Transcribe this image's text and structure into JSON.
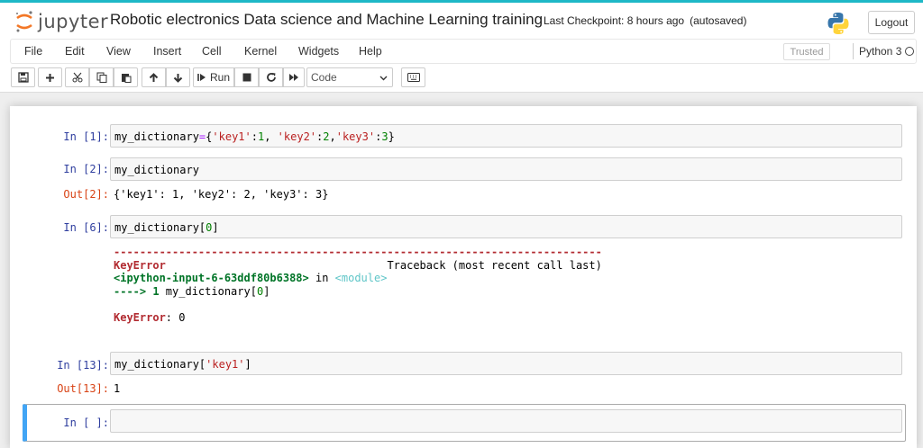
{
  "header": {
    "logo_text": "jupyter",
    "notebook_title": "Robotic electronics Data science and Machine Learning training",
    "checkpoint": "Last Checkpoint: 8 hours ago",
    "autosave": "(autosaved)",
    "logout_label": "Logout"
  },
  "menu": {
    "items": [
      "File",
      "Edit",
      "View",
      "Insert",
      "Cell",
      "Kernel",
      "Widgets",
      "Help"
    ],
    "trusted_label": "Trusted",
    "kernel_name": "Python 3"
  },
  "toolbar": {
    "run_label": "Run",
    "cell_type": "Code"
  },
  "cells": {
    "c1": {
      "prompt": "In [1]:",
      "code": [
        "my_dictionary",
        "=",
        "{",
        "'key1'",
        ":",
        "1",
        ", ",
        "'key2'",
        ":",
        "2",
        ",",
        "'key3'",
        ":",
        "3",
        "}"
      ]
    },
    "c2": {
      "prompt": "In [2]:",
      "code": "my_dictionary",
      "out_prompt": "Out[2]:",
      "output": "{'key1': 1, 'key2': 2, 'key3': 3}"
    },
    "c3": {
      "prompt": "In [6]:",
      "code": [
        "my_dictionary",
        "[",
        "0",
        "]"
      ],
      "traceback": {
        "dashes": "---------------------------------------------------------------------------",
        "error_name": "KeyError",
        "traceback_label": "Traceback (most recent call last)",
        "input_ref": "<ipython-input-6-63ddf80b6388>",
        "in_word": " in ",
        "module": "<module>",
        "arrow": "----> 1 ",
        "line_code": "my_dictionary",
        "line_bracket_open": "[",
        "line_index": "0",
        "line_bracket_close": "]",
        "final_error": "KeyError",
        "final_msg": ": 0"
      }
    },
    "c4": {
      "prompt": "In [13]:",
      "code": [
        "my_dictionary",
        "[",
        "'key1'",
        "]"
      ],
      "out_prompt": "Out[13]:",
      "output": "1"
    },
    "c5": {
      "prompt": "In [ ]:",
      "code": ""
    }
  },
  "colors": {
    "accent": "#42a5f5",
    "in_prompt": "#303f9f",
    "out_prompt": "#d84315",
    "string": "#ba2121",
    "number": "#008000",
    "operator": "#aa22ff"
  },
  "icons": [
    "jupyter-logo-icon",
    "python-logo-icon",
    "save-icon",
    "plus-icon",
    "cut-icon",
    "copy-icon",
    "paste-icon",
    "arrow-up-icon",
    "arrow-down-icon",
    "step-forward-icon",
    "stop-icon",
    "restart-icon",
    "fast-forward-icon",
    "keyboard-icon"
  ]
}
